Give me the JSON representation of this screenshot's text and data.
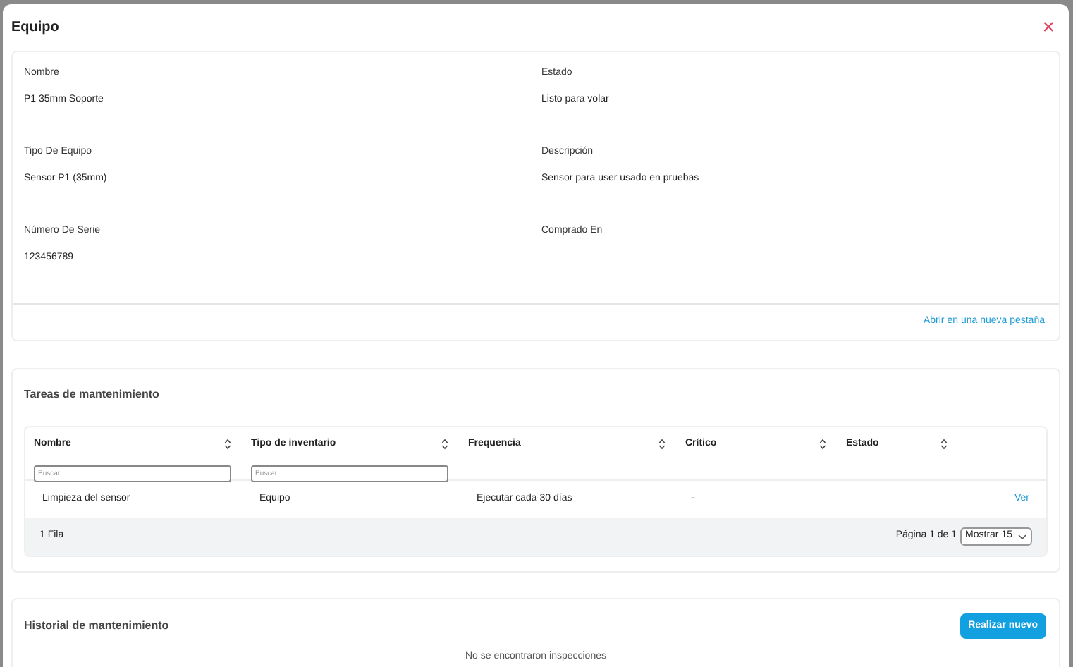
{
  "window": {
    "title": "Equipo",
    "close": "×"
  },
  "details": {
    "fields": [
      {
        "label": "Nombre",
        "value": "P1 35mm Soporte"
      },
      {
        "label": "Estado",
        "value": "Listo para volar"
      },
      {
        "label": "Tipo De Equipo",
        "value": "Sensor P1 (35mm)"
      },
      {
        "label": "Descripción",
        "value": "Sensor para user usado en pruebas"
      },
      {
        "label": "Número De Serie",
        "value": "123456789"
      },
      {
        "label": "Comprado En"
      }
    ],
    "link": "Abrir en una nueva pestaña"
  },
  "tasks": {
    "title": "Tareas de mantenimiento",
    "columns": [
      {
        "label": "Nombre",
        "placeholder": "Buscar..."
      },
      {
        "label": "Tipo de inventario",
        "placeholder": "Buscar..."
      },
      {
        "label": "Frequencia"
      },
      {
        "label": "Crítico"
      },
      {
        "label": "Estado"
      }
    ],
    "rows": [
      {
        "cells": [
          "Limpieza del sensor",
          "Equipo",
          "Ejecutar cada 30 días",
          "-"
        ],
        "action": "Ver"
      }
    ],
    "row_count": "1 Fila",
    "page": "Página 1 de 1",
    "page_size": "Mostrar 15"
  },
  "history": {
    "title": "Historial de mantenimiento",
    "button": "Realizar nuevo",
    "empty": "No se encontraron inspecciones"
  }
}
